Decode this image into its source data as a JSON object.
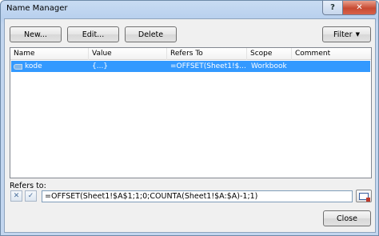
{
  "window": {
    "title": "Name Manager",
    "help_label": "?",
    "close_label": "✕"
  },
  "toolbar": {
    "new_label": "New...",
    "edit_label": "Edit...",
    "delete_label": "Delete",
    "filter_label": "Filter",
    "filter_caret": "▼"
  },
  "table": {
    "columns": [
      "Name",
      "Value",
      "Refers To",
      "Scope",
      "Comment"
    ],
    "rows": [
      {
        "name": "kode",
        "value": "{...}",
        "refers_to": "=OFFSET(Sheet1!$...",
        "scope": "Workbook",
        "comment": "",
        "selected": true
      }
    ]
  },
  "refers_to": {
    "label": "Refers to:",
    "value": "=OFFSET(Sheet1!$A$1;1;0;COUNTA(Sheet1!$A:$A)-1;1)",
    "cancel_glyph": "✕",
    "commit_glyph": "✓"
  },
  "footer": {
    "close_label": "Close"
  },
  "colors": {
    "selection": "#3399ff",
    "title_gradient": "#c9dcf2",
    "close_button": "#c74a32"
  }
}
